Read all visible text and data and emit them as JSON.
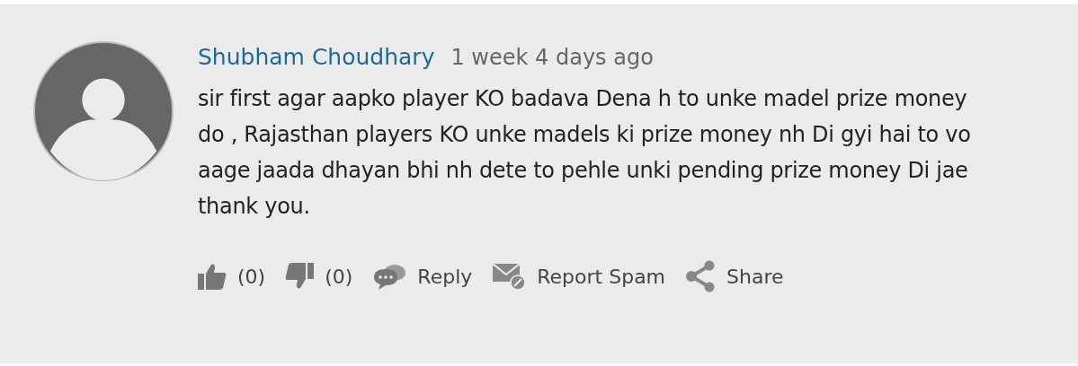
{
  "comment": {
    "author": "Shubham Choudhary",
    "time": "1 week 4 days ago",
    "text": "sir first agar aapko player KO badava Dena h to unke madel prize money do , Rajasthan players KO unke madels ki prize money nh Di gyi hai to vo aage jaada dhayan bhi nh dete to pehle unki pending prize money Di jae thank you."
  },
  "actions": [
    {
      "kind": "like",
      "label": "(0)"
    },
    {
      "kind": "dislike",
      "label": "(0)"
    },
    {
      "kind": "reply",
      "label": "Reply"
    },
    {
      "kind": "spam",
      "label": "Report Spam"
    },
    {
      "kind": "share",
      "label": "Share"
    }
  ]
}
